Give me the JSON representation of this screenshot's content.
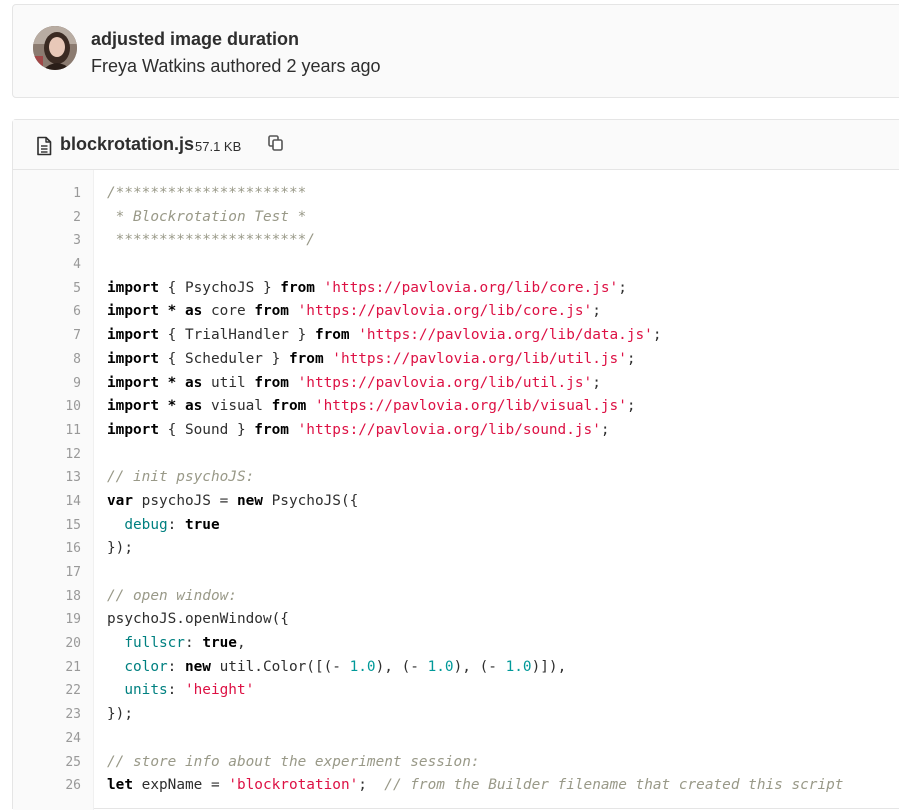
{
  "commit": {
    "title": "adjusted image duration",
    "author": "Freya Watkins",
    "action": "authored",
    "time": "2 years ago",
    "avatar_icon": "user-avatar"
  },
  "file": {
    "name": "blockrotation.js",
    "size": "57.1 KB",
    "file_icon": "file-text-icon",
    "copy_icon": "copy-icon"
  },
  "colors": {
    "string": "#dd1144",
    "number": "#009999",
    "property": "#008080",
    "comment": "#999988",
    "keyword": "#000000"
  },
  "code_lines": [
    {
      "n": "1",
      "tokens": [
        {
          "t": "/**********************",
          "c": "comment"
        }
      ]
    },
    {
      "n": "2",
      "tokens": [
        {
          "t": " * Blockrotation Test *",
          "c": "comment"
        }
      ]
    },
    {
      "n": "3",
      "tokens": [
        {
          "t": " **********************/",
          "c": "comment"
        }
      ]
    },
    {
      "n": "4",
      "tokens": []
    },
    {
      "n": "5",
      "tokens": [
        {
          "t": "import",
          "c": "kw"
        },
        {
          "t": " { PsychoJS } ",
          "c": "plain"
        },
        {
          "t": "from",
          "c": "kw"
        },
        {
          "t": " ",
          "c": "plain"
        },
        {
          "t": "'https://pavlovia.org/lib/core.js'",
          "c": "str"
        },
        {
          "t": ";",
          "c": "plain"
        }
      ]
    },
    {
      "n": "6",
      "tokens": [
        {
          "t": "import",
          "c": "kw"
        },
        {
          "t": " ",
          "c": "plain"
        },
        {
          "t": "*",
          "c": "kw"
        },
        {
          "t": " ",
          "c": "plain"
        },
        {
          "t": "as",
          "c": "kw"
        },
        {
          "t": " core ",
          "c": "plain"
        },
        {
          "t": "from",
          "c": "kw"
        },
        {
          "t": " ",
          "c": "plain"
        },
        {
          "t": "'https://pavlovia.org/lib/core.js'",
          "c": "str"
        },
        {
          "t": ";",
          "c": "plain"
        }
      ]
    },
    {
      "n": "7",
      "tokens": [
        {
          "t": "import",
          "c": "kw"
        },
        {
          "t": " { TrialHandler } ",
          "c": "plain"
        },
        {
          "t": "from",
          "c": "kw"
        },
        {
          "t": " ",
          "c": "plain"
        },
        {
          "t": "'https://pavlovia.org/lib/data.js'",
          "c": "str"
        },
        {
          "t": ";",
          "c": "plain"
        }
      ]
    },
    {
      "n": "8",
      "tokens": [
        {
          "t": "import",
          "c": "kw"
        },
        {
          "t": " { Scheduler } ",
          "c": "plain"
        },
        {
          "t": "from",
          "c": "kw"
        },
        {
          "t": " ",
          "c": "plain"
        },
        {
          "t": "'https://pavlovia.org/lib/util.js'",
          "c": "str"
        },
        {
          "t": ";",
          "c": "plain"
        }
      ]
    },
    {
      "n": "9",
      "tokens": [
        {
          "t": "import",
          "c": "kw"
        },
        {
          "t": " ",
          "c": "plain"
        },
        {
          "t": "*",
          "c": "kw"
        },
        {
          "t": " ",
          "c": "plain"
        },
        {
          "t": "as",
          "c": "kw"
        },
        {
          "t": " util ",
          "c": "plain"
        },
        {
          "t": "from",
          "c": "kw"
        },
        {
          "t": " ",
          "c": "plain"
        },
        {
          "t": "'https://pavlovia.org/lib/util.js'",
          "c": "str"
        },
        {
          "t": ";",
          "c": "plain"
        }
      ]
    },
    {
      "n": "10",
      "tokens": [
        {
          "t": "import",
          "c": "kw"
        },
        {
          "t": " ",
          "c": "plain"
        },
        {
          "t": "*",
          "c": "kw"
        },
        {
          "t": " ",
          "c": "plain"
        },
        {
          "t": "as",
          "c": "kw"
        },
        {
          "t": " visual ",
          "c": "plain"
        },
        {
          "t": "from",
          "c": "kw"
        },
        {
          "t": " ",
          "c": "plain"
        },
        {
          "t": "'https://pavlovia.org/lib/visual.js'",
          "c": "str"
        },
        {
          "t": ";",
          "c": "plain"
        }
      ]
    },
    {
      "n": "11",
      "tokens": [
        {
          "t": "import",
          "c": "kw"
        },
        {
          "t": " { Sound } ",
          "c": "plain"
        },
        {
          "t": "from",
          "c": "kw"
        },
        {
          "t": " ",
          "c": "plain"
        },
        {
          "t": "'https://pavlovia.org/lib/sound.js'",
          "c": "str"
        },
        {
          "t": ";",
          "c": "plain"
        }
      ]
    },
    {
      "n": "12",
      "tokens": []
    },
    {
      "n": "13",
      "tokens": [
        {
          "t": "// init psychoJS:",
          "c": "comment"
        }
      ]
    },
    {
      "n": "14",
      "tokens": [
        {
          "t": "var",
          "c": "kw"
        },
        {
          "t": " psychoJS = ",
          "c": "plain"
        },
        {
          "t": "new",
          "c": "kw"
        },
        {
          "t": " PsychoJS({",
          "c": "plain"
        }
      ]
    },
    {
      "n": "15",
      "tokens": [
        {
          "t": "  ",
          "c": "plain"
        },
        {
          "t": "debug",
          "c": "prop"
        },
        {
          "t": ": ",
          "c": "plain"
        },
        {
          "t": "true",
          "c": "kw"
        }
      ]
    },
    {
      "n": "16",
      "tokens": [
        {
          "t": "});",
          "c": "plain"
        }
      ]
    },
    {
      "n": "17",
      "tokens": []
    },
    {
      "n": "18",
      "tokens": [
        {
          "t": "// open window:",
          "c": "comment"
        }
      ]
    },
    {
      "n": "19",
      "tokens": [
        {
          "t": "psychoJS.openWindow({",
          "c": "plain"
        }
      ]
    },
    {
      "n": "20",
      "tokens": [
        {
          "t": "  ",
          "c": "plain"
        },
        {
          "t": "fullscr",
          "c": "prop"
        },
        {
          "t": ": ",
          "c": "plain"
        },
        {
          "t": "true",
          "c": "kw"
        },
        {
          "t": ",",
          "c": "plain"
        }
      ]
    },
    {
      "n": "21",
      "tokens": [
        {
          "t": "  ",
          "c": "plain"
        },
        {
          "t": "color",
          "c": "prop"
        },
        {
          "t": ": ",
          "c": "plain"
        },
        {
          "t": "new",
          "c": "kw"
        },
        {
          "t": " util.Color([(- ",
          "c": "plain"
        },
        {
          "t": "1.0",
          "c": "num"
        },
        {
          "t": "), (- ",
          "c": "plain"
        },
        {
          "t": "1.0",
          "c": "num"
        },
        {
          "t": "), (- ",
          "c": "plain"
        },
        {
          "t": "1.0",
          "c": "num"
        },
        {
          "t": ")]),",
          "c": "plain"
        }
      ]
    },
    {
      "n": "22",
      "tokens": [
        {
          "t": "  ",
          "c": "plain"
        },
        {
          "t": "units",
          "c": "prop"
        },
        {
          "t": ": ",
          "c": "plain"
        },
        {
          "t": "'height'",
          "c": "str"
        }
      ]
    },
    {
      "n": "23",
      "tokens": [
        {
          "t": "});",
          "c": "plain"
        }
      ]
    },
    {
      "n": "24",
      "tokens": []
    },
    {
      "n": "25",
      "tokens": [
        {
          "t": "// store info about the experiment session:",
          "c": "comment"
        }
      ]
    },
    {
      "n": "26",
      "tokens": [
        {
          "t": "let",
          "c": "kw"
        },
        {
          "t": " expName = ",
          "c": "plain"
        },
        {
          "t": "'blockrotation'",
          "c": "str"
        },
        {
          "t": ";  ",
          "c": "plain"
        },
        {
          "t": "// from the Builder filename that created this script",
          "c": "comment"
        }
      ]
    }
  ]
}
